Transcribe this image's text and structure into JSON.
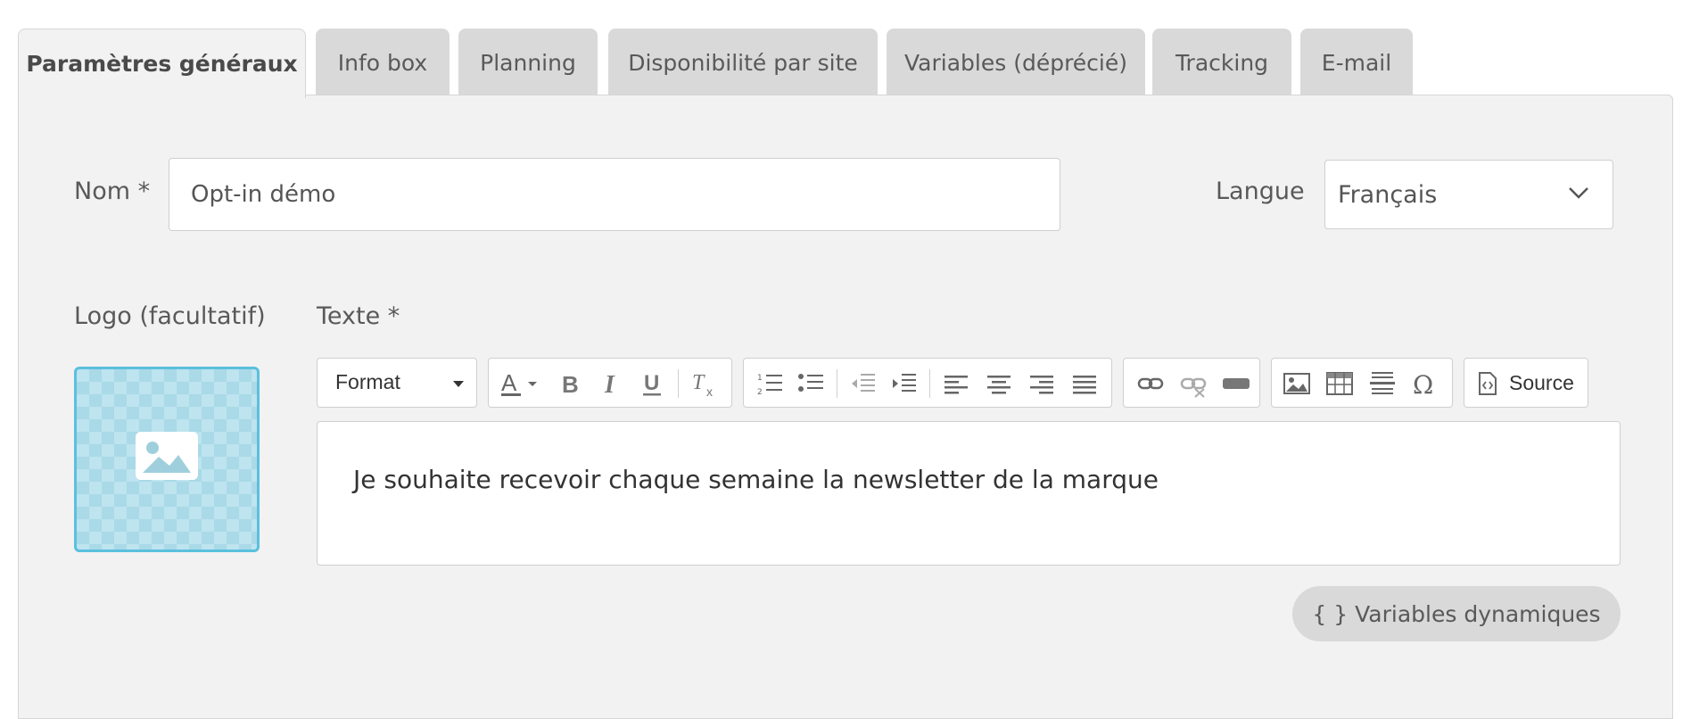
{
  "tabs": [
    {
      "label": "Paramètres généraux",
      "active": true
    },
    {
      "label": "Info box"
    },
    {
      "label": "Planning"
    },
    {
      "label": "Disponibilité par site"
    },
    {
      "label": "Variables (déprécié)"
    },
    {
      "label": "Tracking"
    },
    {
      "label": "E-mail"
    }
  ],
  "form": {
    "name_label": "Nom *",
    "name_value": "Opt-in démo",
    "language_label": "Langue",
    "language_value": "Français",
    "logo_label": "Logo (facultatif)",
    "text_label": "Texte *"
  },
  "toolbar": {
    "format_label": "Format",
    "source_label": "Source",
    "icons": [
      "text-color-icon",
      "bold-icon",
      "italic-icon",
      "underline-icon",
      "remove-format-icon",
      "numbered-list-icon",
      "bullet-list-icon",
      "outdent-icon",
      "indent-icon",
      "align-left-icon",
      "align-center-icon",
      "align-right-icon",
      "justify-icon",
      "link-icon",
      "unlink-icon",
      "anchor-icon",
      "image-icon",
      "table-icon",
      "horizontal-line-icon",
      "special-char-icon",
      "source-icon"
    ]
  },
  "editor": {
    "content": "Je souhaite recevoir chaque semaine la newsletter de la marque"
  },
  "dynamic_vars_label": "{ } Variables dynamiques",
  "colors": {
    "accent": "#5bc0de",
    "panel": "#f2f2f2",
    "tab": "#d9d9d9"
  }
}
